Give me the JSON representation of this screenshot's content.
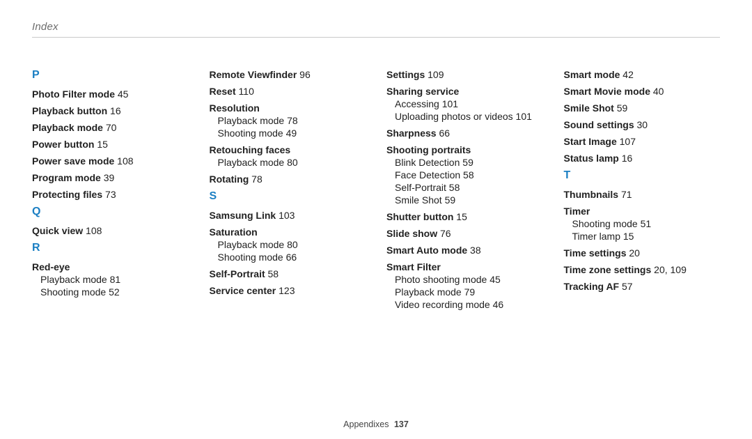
{
  "header": {
    "title": "Index"
  },
  "footer": {
    "section": "Appendixes",
    "pageNumber": "137"
  },
  "columns": [
    {
      "blocks": [
        {
          "type": "letter",
          "letter": "P",
          "entries": [
            {
              "topic": "Photo Filter mode",
              "pages": "45"
            },
            {
              "topic": "Playback button",
              "pages": "16"
            },
            {
              "topic": "Playback mode",
              "pages": "70"
            },
            {
              "topic": "Power button",
              "pages": "15"
            },
            {
              "topic": "Power save mode",
              "pages": "108"
            },
            {
              "topic": "Program mode",
              "pages": "39"
            },
            {
              "topic": "Protecting files",
              "pages": "73"
            }
          ]
        },
        {
          "type": "letter",
          "letter": "Q",
          "entries": [
            {
              "topic": "Quick view",
              "pages": "108"
            }
          ]
        },
        {
          "type": "letter",
          "letter": "R",
          "entries": [
            {
              "topic": "Red-eye",
              "subs": [
                {
                  "label": "Playback mode",
                  "pages": "81"
                },
                {
                  "label": "Shooting mode",
                  "pages": "52"
                }
              ]
            }
          ]
        }
      ]
    },
    {
      "blocks": [
        {
          "type": "continuation",
          "entries": [
            {
              "topic": "Remote Viewfinder",
              "pages": "96"
            },
            {
              "topic": "Reset",
              "pages": "110"
            },
            {
              "topic": "Resolution",
              "subs": [
                {
                  "label": "Playback mode",
                  "pages": "78"
                },
                {
                  "label": "Shooting mode",
                  "pages": "49"
                }
              ]
            },
            {
              "topic": "Retouching faces",
              "subs": [
                {
                  "label": "Playback mode",
                  "pages": "80"
                }
              ]
            },
            {
              "topic": "Rotating",
              "pages": "78"
            }
          ]
        },
        {
          "type": "letter",
          "letter": "S",
          "entries": [
            {
              "topic": "Samsung Link",
              "pages": "103"
            },
            {
              "topic": "Saturation",
              "subs": [
                {
                  "label": "Playback mode",
                  "pages": "80"
                },
                {
                  "label": "Shooting mode",
                  "pages": "66"
                }
              ]
            },
            {
              "topic": "Self-Portrait",
              "pages": "58"
            },
            {
              "topic": "Service center",
              "pages": "123"
            }
          ]
        }
      ]
    },
    {
      "blocks": [
        {
          "type": "continuation",
          "entries": [
            {
              "topic": "Settings",
              "pages": "109"
            },
            {
              "topic": "Sharing service",
              "subs": [
                {
                  "label": "Accessing",
                  "pages": "101"
                },
                {
                  "label": "Uploading photos or videos",
                  "pages": "101"
                }
              ]
            },
            {
              "topic": "Sharpness",
              "pages": "66"
            },
            {
              "topic": "Shooting portraits",
              "subs": [
                {
                  "label": "Blink Detection",
                  "pages": "59"
                },
                {
                  "label": "Face Detection",
                  "pages": "58"
                },
                {
                  "label": "Self-Portrait",
                  "pages": "58"
                },
                {
                  "label": "Smile Shot",
                  "pages": "59"
                }
              ]
            },
            {
              "topic": "Shutter button",
              "pages": "15"
            },
            {
              "topic": "Slide show",
              "pages": "76"
            },
            {
              "topic": "Smart Auto mode",
              "pages": "38"
            },
            {
              "topic": "Smart Filter",
              "subs": [
                {
                  "label": "Photo shooting mode",
                  "pages": "45"
                },
                {
                  "label": "Playback mode",
                  "pages": "79"
                },
                {
                  "label": "Video recording mode",
                  "pages": "46"
                }
              ]
            }
          ]
        }
      ]
    },
    {
      "blocks": [
        {
          "type": "continuation",
          "entries": [
            {
              "topic": "Smart mode",
              "pages": "42"
            },
            {
              "topic": "Smart Movie mode",
              "pages": "40"
            },
            {
              "topic": "Smile Shot",
              "pages": "59"
            },
            {
              "topic": "Sound settings",
              "pages": "30"
            },
            {
              "topic": "Start Image",
              "pages": "107"
            },
            {
              "topic": "Status lamp",
              "pages": "16"
            }
          ]
        },
        {
          "type": "letter",
          "letter": "T",
          "entries": [
            {
              "topic": "Thumbnails",
              "pages": "71"
            },
            {
              "topic": "Timer",
              "subs": [
                {
                  "label": "Shooting mode",
                  "pages": "51"
                },
                {
                  "label": "Timer lamp",
                  "pages": "15"
                }
              ]
            },
            {
              "topic": "Time settings",
              "pages": "20"
            },
            {
              "topic": "Time zone settings",
              "pages": "20, 109"
            },
            {
              "topic": "Tracking AF",
              "pages": "57"
            }
          ]
        }
      ]
    }
  ]
}
